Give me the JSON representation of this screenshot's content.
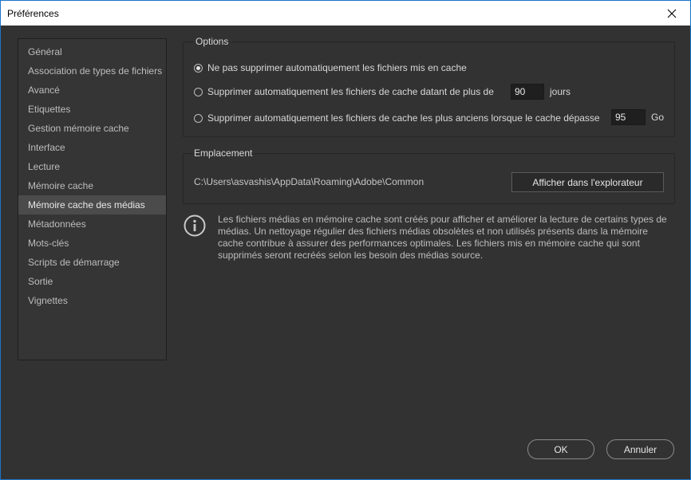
{
  "window": {
    "title": "Préférences"
  },
  "sidebar": {
    "items": [
      {
        "label": "Général"
      },
      {
        "label": "Association de types de fichiers"
      },
      {
        "label": "Avancé"
      },
      {
        "label": "Etiquettes"
      },
      {
        "label": "Gestion mémoire cache"
      },
      {
        "label": "Interface"
      },
      {
        "label": "Lecture"
      },
      {
        "label": "Mémoire cache"
      },
      {
        "label": "Mémoire cache des médias",
        "selected": true
      },
      {
        "label": "Métadonnées"
      },
      {
        "label": "Mots-clés"
      },
      {
        "label": "Scripts de démarrage"
      },
      {
        "label": "Sortie"
      },
      {
        "label": "Vignettes"
      }
    ]
  },
  "options": {
    "title": "Options",
    "radio1": {
      "label": "Ne pas supprimer automatiquement les fichiers mis en cache",
      "checked": true
    },
    "radio2": {
      "label": "Supprimer automatiquement les fichiers de cache datant de plus de",
      "value": "90",
      "unit": "jours",
      "checked": false
    },
    "radio3": {
      "label": "Supprimer automatiquement les fichiers de cache les plus anciens lorsque le cache dépasse",
      "value": "95",
      "unit": "Go",
      "checked": false
    }
  },
  "location": {
    "title": "Emplacement",
    "path": "C:\\Users\\asvashis\\AppData\\Roaming\\Adobe\\Common",
    "button_label": "Afficher dans l'explorateur"
  },
  "info": {
    "icon": "info-icon",
    "text": "Les fichiers médias en mémoire cache sont créés pour afficher et améliorer la lecture de certains types de médias. Un nettoyage régulier des fichiers médias obsolètes et non utilisés présents dans la mémoire cache contribue à assurer des performances optimales. Les fichiers mis en mémoire cache qui sont supprimés seront recréés selon les besoin des médias source."
  },
  "footer": {
    "ok_label": "OK",
    "cancel_label": "Annuler"
  }
}
